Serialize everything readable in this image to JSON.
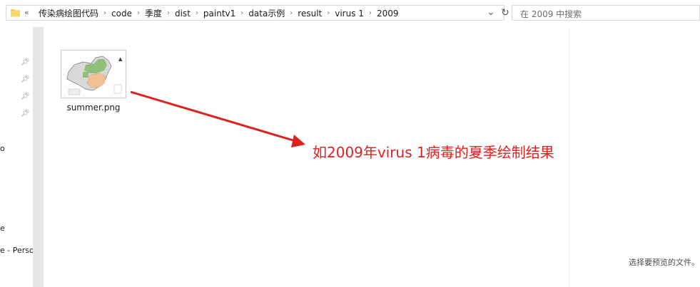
{
  "address_bar": {
    "overflow": "«",
    "crumbs": [
      "传染病绘图代码",
      "code",
      "季度",
      "dist",
      "paintv1",
      "data示例",
      "result",
      "virus 1",
      "2009"
    ],
    "dropdown_icon": "chevron-down-icon",
    "refresh_icon": "refresh-icon"
  },
  "search": {
    "placeholder": "在 2009 中搜索"
  },
  "nav": {
    "partial_items": [
      "o",
      "e",
      "e - Perso"
    ]
  },
  "files": [
    {
      "name": "summer.png"
    }
  ],
  "annotation": {
    "text": "如2009年virus 1病毒的夏季绘制结果",
    "color": "#e0201c"
  },
  "preview_pane": {
    "text": "选择要预览的文件。"
  }
}
